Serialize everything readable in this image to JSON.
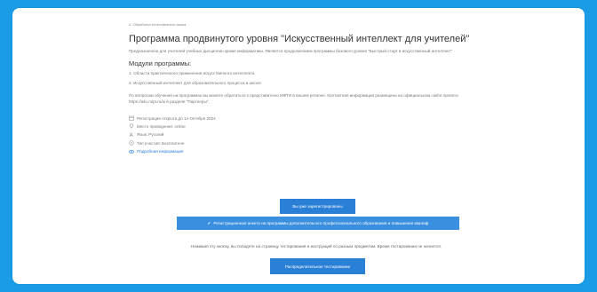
{
  "breadcrumb": "4. Обработка естественного языка",
  "title": "Программа продвинутого уровня \"Искусственный интеллект для учителей\"",
  "description": "Предназначена для учителей учебных дисциплин кроме информатики. Является продолжением программы базового уровня \"Быстрый старт в искусственный интеллект\"",
  "modules_heading": "Модули программы:",
  "modules": [
    "1. Области практического применения искусственного интеллекта",
    "2. Искусственный интеллект для образовательного процесса в школе"
  ],
  "note": "По вопросам обучения на программах вы можете обратиться к представителю МФТИ в вашем регионе. Контактная информация размещена на официальном сайте проекта https://ailu.mipt.ru/ai в разделе \"Партнеры\".",
  "info": {
    "registration": "Регистрация открыта до 14 Октября 2024",
    "location": "Место проведения: online",
    "language": "Язык: Русский",
    "participation": "Тип участия: Бесплатное",
    "details_link": "Подробная информация"
  },
  "buttons": {
    "registered": "Вы уже зарегистрированы",
    "accepted": "Регистрационная анкета на программы дополнительного профессионального образования и повышения квалиф",
    "preliminary_test": "Распределительное тестирование"
  },
  "hint": "Нажимая эту кнопку, вы попадете на страницу тестирования и инструкций по разным предметам. Время тестирования не начнется.",
  "colors": {
    "frame_background": "#1a9be6",
    "accent": "#2a7fd6",
    "link": "#1f7ad6"
  }
}
